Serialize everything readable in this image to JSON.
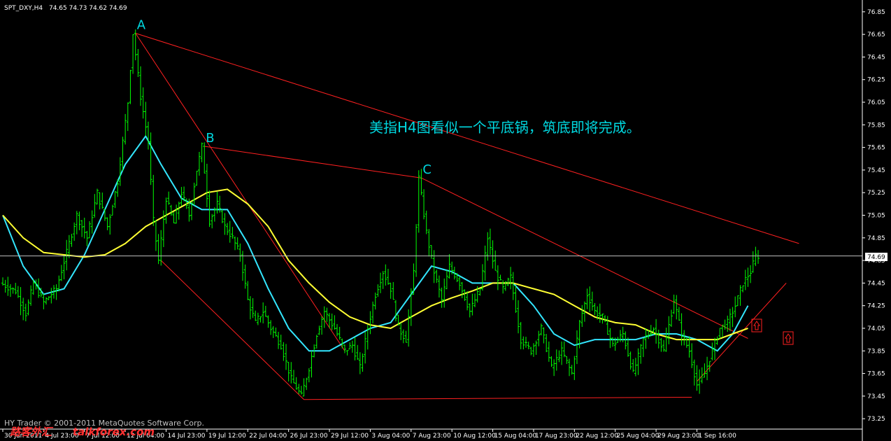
{
  "header": {
    "symbol": "SPT_DXY,H4",
    "ohlc": "74.65 74.73 74.62 74.69"
  },
  "annotation": "美指H4图看似一个平底锅，筑底即将完成。",
  "current_price_label": "74.69",
  "watermark": "HY Trader © 2001-2011 MetaQuotes Software Corp.",
  "logo": {
    "chars": "路客外汇",
    "site": "talkforex.com"
  },
  "colors": {
    "background": "#000000",
    "up_bar": "#00ff00",
    "down_bar": "#00ff00",
    "ma_fast": "#33e6ff",
    "ma_slow": "#ffff33",
    "trendline": "#ff2020",
    "annotation": "#00d8e0",
    "price_line": "#bfbfbf",
    "logo": "#ff3030"
  },
  "chart_data": {
    "type": "candlestick",
    "timeframe": "H4",
    "y_axis": {
      "range": [
        73.22,
        76.88
      ],
      "ticks": [
        76.85,
        76.65,
        76.45,
        76.25,
        76.05,
        75.85,
        75.65,
        75.45,
        75.25,
        75.05,
        74.85,
        74.65,
        74.45,
        74.25,
        74.05,
        73.85,
        73.65,
        73.45,
        73.25
      ],
      "tick_labels": [
        "76.85",
        "76.65",
        "76.45",
        "76.25",
        "76.05",
        "75.85",
        "75.65",
        "75.45",
        "75.25",
        "75.05",
        "74.85",
        "74.65",
        "74.45",
        "74.25",
        "74.05",
        "73.85",
        "73.65",
        "73.45",
        "73.25"
      ]
    },
    "x_axis": {
      "range": [
        0,
        336
      ],
      "ticks": [
        0,
        16,
        32,
        48,
        64,
        80,
        96,
        112,
        128,
        144,
        160,
        176,
        192,
        208,
        224,
        240,
        256,
        272,
        288
      ],
      "tick_labels": [
        "30 Jun 2011",
        "4 Jul 23:00",
        "7 Jul 12:00",
        "12 Jul 04:00",
        "14 Jul 23:00",
        "19 Jul 12:00",
        "22 Jul 04:00",
        "26 Jul 23:00",
        "29 Jul 12:00",
        "3 Aug 04:00",
        "7 Aug 23:00",
        "10 Aug 12:00",
        "15 Aug 04:00",
        "17 Aug 23:00",
        "22 Aug 12:00",
        "25 Aug 04:00",
        "29 Aug 23:00",
        "1 Sep 16:00"
      ]
    },
    "pivots": [
      {
        "label": "A",
        "bar": 52,
        "price": 76.66
      },
      {
        "label": "B",
        "bar": 79,
        "price": 75.66
      },
      {
        "label": "C",
        "bar": 164,
        "price": 75.38
      }
    ],
    "price_path": [
      [
        0,
        74.45
      ],
      [
        6,
        74.38
      ],
      [
        10,
        74.18
      ],
      [
        13,
        74.45
      ],
      [
        17,
        74.28
      ],
      [
        22,
        74.4
      ],
      [
        26,
        74.72
      ],
      [
        30,
        75.05
      ],
      [
        34,
        74.85
      ],
      [
        38,
        75.25
      ],
      [
        42,
        74.95
      ],
      [
        46,
        75.35
      ],
      [
        50,
        76.05
      ],
      [
        52,
        76.66
      ],
      [
        55,
        76.1
      ],
      [
        58,
        75.7
      ],
      [
        60,
        75.0
      ],
      [
        62,
        74.65
      ],
      [
        65,
        75.2
      ],
      [
        68,
        74.98
      ],
      [
        71,
        75.25
      ],
      [
        74,
        75.05
      ],
      [
        77,
        75.45
      ],
      [
        79,
        75.66
      ],
      [
        82,
        75.0
      ],
      [
        85,
        75.15
      ],
      [
        88,
        74.95
      ],
      [
        91,
        74.85
      ],
      [
        94,
        74.7
      ],
      [
        97,
        74.3
      ],
      [
        100,
        74.1
      ],
      [
        103,
        74.2
      ],
      [
        106,
        74.05
      ],
      [
        110,
        73.9
      ],
      [
        114,
        73.6
      ],
      [
        118,
        73.45
      ],
      [
        121,
        73.7
      ],
      [
        124,
        74.0
      ],
      [
        127,
        74.2
      ],
      [
        131,
        74.05
      ],
      [
        135,
        73.85
      ],
      [
        138,
        73.9
      ],
      [
        141,
        73.7
      ],
      [
        144,
        74.05
      ],
      [
        147,
        74.35
      ],
      [
        150,
        74.55
      ],
      [
        153,
        74.4
      ],
      [
        156,
        74.05
      ],
      [
        159,
        73.95
      ],
      [
        162,
        74.55
      ],
      [
        164,
        75.38
      ],
      [
        167,
        74.9
      ],
      [
        170,
        74.55
      ],
      [
        173,
        74.3
      ],
      [
        176,
        74.6
      ],
      [
        180,
        74.45
      ],
      [
        184,
        74.2
      ],
      [
        188,
        74.4
      ],
      [
        191,
        74.85
      ],
      [
        194,
        74.55
      ],
      [
        197,
        74.4
      ],
      [
        200,
        74.5
      ],
      [
        204,
        73.95
      ],
      [
        208,
        73.85
      ],
      [
        212,
        74.05
      ],
      [
        216,
        73.7
      ],
      [
        220,
        73.85
      ],
      [
        224,
        73.65
      ],
      [
        227,
        74.1
      ],
      [
        230,
        74.35
      ],
      [
        233,
        74.2
      ],
      [
        236,
        74.15
      ],
      [
        240,
        73.9
      ],
      [
        244,
        74.0
      ],
      [
        248,
        73.65
      ],
      [
        252,
        73.95
      ],
      [
        256,
        74.05
      ],
      [
        260,
        73.85
      ],
      [
        264,
        74.3
      ],
      [
        267,
        74.0
      ],
      [
        270,
        73.85
      ],
      [
        273,
        73.55
      ],
      [
        276,
        73.65
      ],
      [
        279,
        73.85
      ],
      [
        282,
        74.05
      ],
      [
        285,
        74.1
      ],
      [
        288,
        74.25
      ],
      [
        291,
        74.45
      ],
      [
        294,
        74.55
      ],
      [
        296,
        74.69
      ]
    ],
    "series": [
      {
        "name": "",
        "color": "#33e6ff",
        "points": [
          [
            0,
            75.05
          ],
          [
            8,
            74.6
          ],
          [
            16,
            74.35
          ],
          [
            24,
            74.4
          ],
          [
            32,
            74.7
          ],
          [
            40,
            75.1
          ],
          [
            48,
            75.5
          ],
          [
            56,
            75.75
          ],
          [
            62,
            75.5
          ],
          [
            70,
            75.2
          ],
          [
            78,
            75.1
          ],
          [
            88,
            75.1
          ],
          [
            96,
            74.8
          ],
          [
            104,
            74.4
          ],
          [
            112,
            74.05
          ],
          [
            120,
            73.85
          ],
          [
            128,
            73.85
          ],
          [
            136,
            73.95
          ],
          [
            144,
            74.05
          ],
          [
            152,
            74.1
          ],
          [
            160,
            74.35
          ],
          [
            168,
            74.6
          ],
          [
            176,
            74.55
          ],
          [
            184,
            74.45
          ],
          [
            192,
            74.45
          ],
          [
            200,
            74.45
          ],
          [
            208,
            74.25
          ],
          [
            216,
            74.0
          ],
          [
            224,
            73.9
          ],
          [
            232,
            73.95
          ],
          [
            240,
            73.95
          ],
          [
            248,
            73.95
          ],
          [
            256,
            74.0
          ],
          [
            264,
            74.0
          ],
          [
            272,
            73.95
          ],
          [
            280,
            73.85
          ],
          [
            286,
            74.0
          ],
          [
            292,
            74.25
          ]
        ]
      },
      {
        "name": "",
        "color": "#ffff33",
        "points": [
          [
            0,
            75.05
          ],
          [
            8,
            74.85
          ],
          [
            16,
            74.72
          ],
          [
            24,
            74.7
          ],
          [
            32,
            74.68
          ],
          [
            40,
            74.7
          ],
          [
            48,
            74.8
          ],
          [
            56,
            74.95
          ],
          [
            64,
            75.05
          ],
          [
            72,
            75.15
          ],
          [
            80,
            75.25
          ],
          [
            88,
            75.28
          ],
          [
            96,
            75.15
          ],
          [
            104,
            74.95
          ],
          [
            112,
            74.65
          ],
          [
            120,
            74.45
          ],
          [
            128,
            74.28
          ],
          [
            136,
            74.15
          ],
          [
            144,
            74.08
          ],
          [
            152,
            74.05
          ],
          [
            160,
            74.15
          ],
          [
            168,
            74.25
          ],
          [
            176,
            74.32
          ],
          [
            184,
            74.38
          ],
          [
            192,
            74.45
          ],
          [
            200,
            74.45
          ],
          [
            208,
            74.4
          ],
          [
            216,
            74.35
          ],
          [
            224,
            74.25
          ],
          [
            232,
            74.15
          ],
          [
            240,
            74.1
          ],
          [
            248,
            74.08
          ],
          [
            256,
            74.0
          ],
          [
            264,
            73.95
          ],
          [
            272,
            73.95
          ],
          [
            280,
            73.95
          ],
          [
            286,
            74.0
          ],
          [
            292,
            74.05
          ]
        ]
      }
    ],
    "trendlines": [
      [
        [
          52,
          76.66
        ],
        [
          312,
          74.8
        ]
      ],
      [
        [
          52,
          76.66
        ],
        [
          134,
          73.85
        ]
      ],
      [
        [
          79,
          75.66
        ],
        [
          164,
          75.38
        ]
      ],
      [
        [
          164,
          75.38
        ],
        [
          292,
          73.96
        ]
      ],
      [
        [
          62,
          74.65
        ],
        [
          118,
          73.42
        ]
      ],
      [
        [
          118,
          73.42
        ],
        [
          270,
          73.44
        ]
      ],
      [
        [
          272,
          73.58
        ],
        [
          307,
          74.45
        ]
      ]
    ],
    "grid": false,
    "current_price": 74.69
  }
}
